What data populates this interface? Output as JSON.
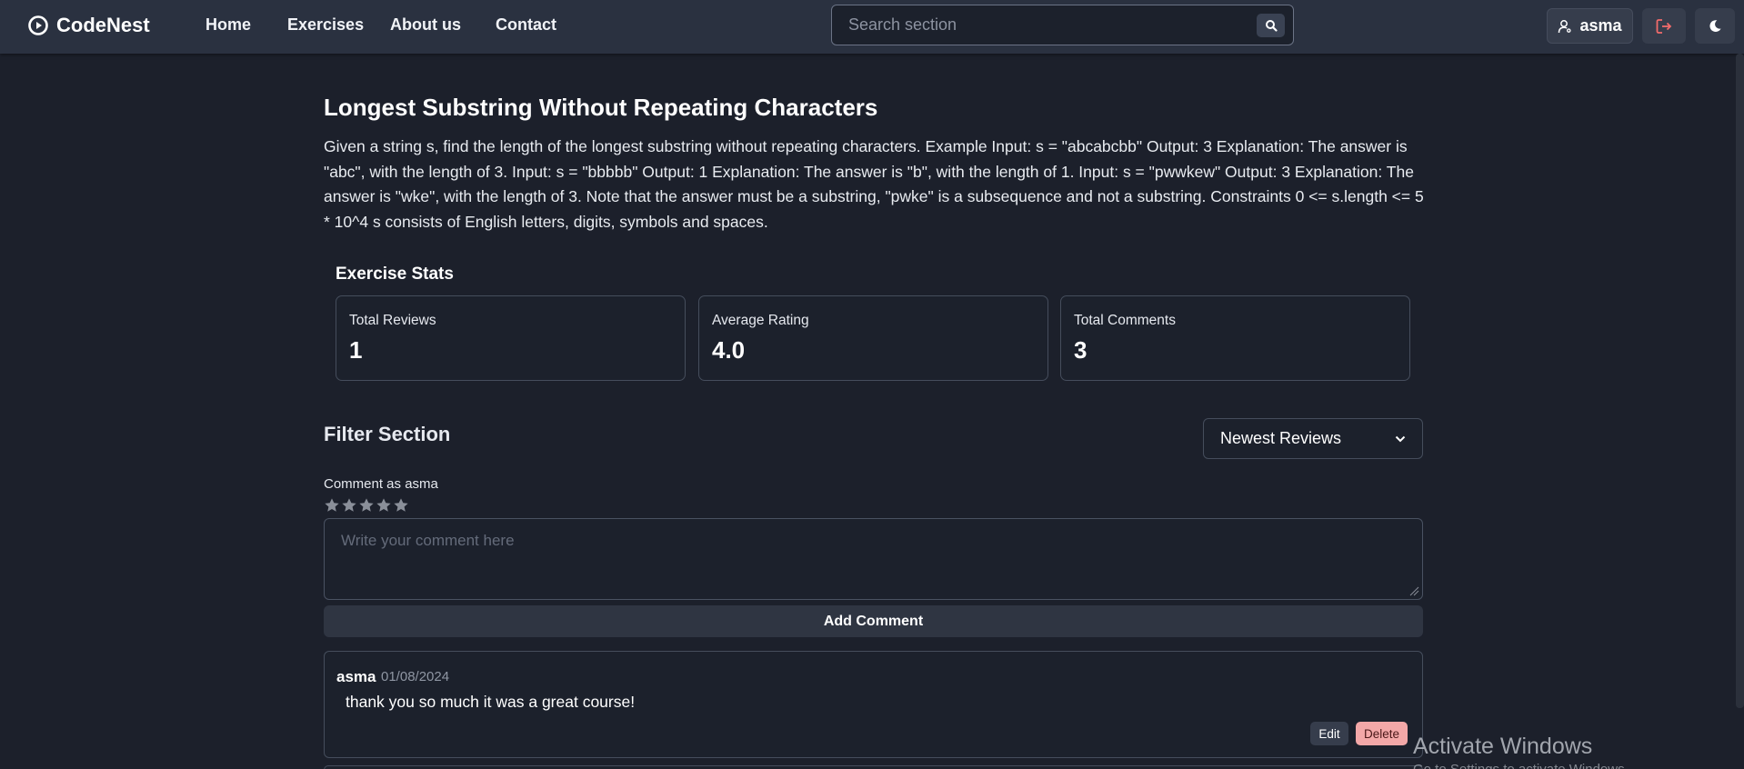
{
  "brand": {
    "name": "CodeNest",
    "icon": "play-circle-icon"
  },
  "nav": {
    "links": [
      {
        "label": "Home"
      },
      {
        "label": "Exercises"
      },
      {
        "label": "About us"
      },
      {
        "label": "Contact"
      }
    ]
  },
  "search": {
    "placeholder": "Search section",
    "icon": "search-icon"
  },
  "user": {
    "name": "asma",
    "icon": "user-icon"
  },
  "actions": {
    "logout_icon": "logout-icon",
    "theme_icon": "moon-icon",
    "logout_color": "#f26b6b"
  },
  "exercise": {
    "title": "Longest Substring Without Repeating Characters",
    "description": "Given a string s, find the length of the longest substring without repeating characters. Example Input: s = \"abcabcbb\" Output: 3 Explanation: The answer is \"abc\", with the length of 3. Input: s = \"bbbbb\" Output: 1 Explanation: The answer is \"b\", with the length of 1. Input: s = \"pwwkew\" Output: 3 Explanation: The answer is \"wke\", with the length of 3. Note that the answer must be a substring, \"pwke\" is a subsequence and not a substring. Constraints 0 <= s.length <= 5 * 10^4 s consists of English letters, digits, symbols and spaces."
  },
  "stats": {
    "heading": "Exercise Stats",
    "cards": [
      {
        "label": "Total Reviews",
        "value": "1"
      },
      {
        "label": "Average Rating",
        "value": "4.0"
      },
      {
        "label": "Total Comments",
        "value": "3"
      }
    ]
  },
  "filter": {
    "title": "Filter Section",
    "selected": "Newest Reviews",
    "icon": "chevron-down-icon"
  },
  "comment_form": {
    "label": "Comment as asma",
    "rating_selected": 0,
    "rating_max": 5,
    "placeholder": "Write your comment here",
    "submit_label": "Add Comment"
  },
  "comments": [
    {
      "author": "asma",
      "date": "01/08/2024",
      "text": "thank you so much it was a great course!",
      "edit_label": "Edit",
      "delete_label": "Delete"
    }
  ],
  "os_watermark": {
    "title": "Activate Windows",
    "subtitle": "Go to Settings to activate Windows."
  },
  "colors": {
    "background": "#1c202b",
    "navbar": "#2a3140",
    "delete": "#f3a8a8"
  }
}
